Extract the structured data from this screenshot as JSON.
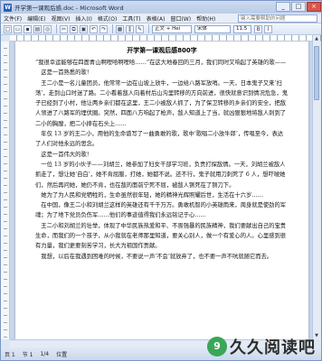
{
  "window": {
    "title": "开学第一课观后感.doc - Microsoft Word",
    "minimize": "_",
    "maximize": "□",
    "close": "×"
  },
  "menu": {
    "items": [
      "文件(F)",
      "编辑(E)",
      "视图(V)",
      "插入(I)",
      "格式(O)",
      "工具(T)",
      "表格(A)",
      "窗口(W)",
      "帮助(H)"
    ],
    "help_placeholder": "键入需要帮助的问题"
  },
  "toolbar": {
    "style_value": "正文 + Hei",
    "font_value": "宋体",
    "size_value": "11.5"
  },
  "document": {
    "title": "开学第一课观后感800字",
    "paragraphs": [
      "“我很幸运能够在四面青山啊哩哈啊哩哈……”在这大地春回的三月，我们同时又响起了英雄的歌——",
      "　这是一首熟悉的歌！",
      "　王二小是一名儿童团员，他常常一边在山坡上放牛，一边给八路军放哨。一天，日本鬼子又来‘扫荡’，走到山口时迷了路。二小看着敌人向着村后山沟里转移的方向前进，很快就意识到情况危急，鬼子已经到了小村，他让两乡亲们都在这里，王二小被敌人抓了，为了保卫转移的乡亲们的安全，把敌人领进了八路军的埋伏圈。突然，四面八方响起了枪声，敌人知道上了当，就凶狠狠地将敌人刺到了二小的胸膛，把二小摔在石头上……",
      "　年仅 13 岁的王二小，用他的生命谱写了一曲勇敢的歌，歌中‘歌唱二小放牛郎’，传唱至今，表达了人们对他永远的思念。",
      "　这是一首伟大的歌！",
      "　一位 13 岁的小伙子——刘胡兰，她参加了妇女干部学习班，负责打探敌情。一天，刘胡兰被敌人抓走了，想让她‘自白’，她不肯屈服，打她，她都不说。还不行，鬼子就用刀刺死了 6 人，想吓唬她们，然后再问她，她仍不肯，也在敌的面前宁死不屈，被敌人铡死在了铡刀下。",
      "　她为了为人民和党牺牲的，生命虽然很年轻，她的精神光辉照耀后世，生活在十六岁……",
      "　在中国，像王二小和刘胡兰这样的英雄还有千千万万。勇敢机智的小英雄雨来，周身就是使劲的军魂；为了地下党员负伤军……他们的事迹值得我们永远铭记于心……",
      "　王二小和刘胡兰的壮举，体现了中华民族热爱和平、不畏强暴的民族精神，我们要献出自己的宝贵生命，而我们的一个孩子，从小我就在老师那里知道，要关心别人，做一个有爱心的人。心里感到很有力量，我们更要刻苦学习，长大为祖国作贡献。",
      "　我想，以后在我遇到困难的时候，不要说一声‘不会’就放弃了，也不要一声不吭就随它而去。"
    ]
  },
  "status": {
    "page": "页 1",
    "section": "节 1",
    "pages": "1/4",
    "position": "位置"
  },
  "logo": {
    "text": "久久阅读吧",
    "icon_glyph": "9"
  }
}
